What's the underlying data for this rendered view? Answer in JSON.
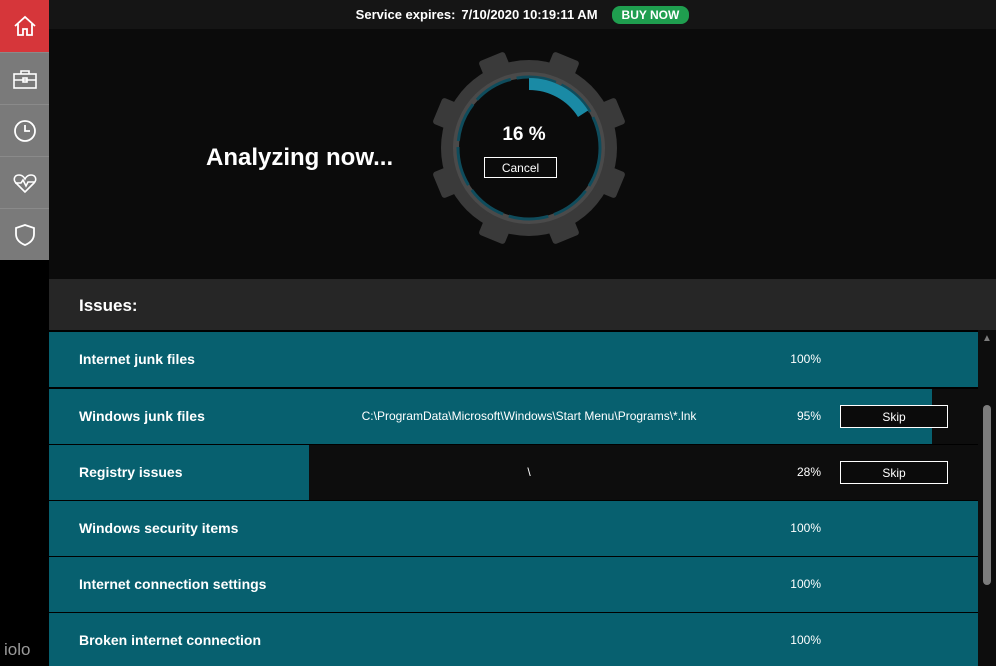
{
  "sidebar": {
    "items": [
      {
        "icon": "home-icon",
        "active": true
      },
      {
        "icon": "briefcase-icon",
        "active": false
      },
      {
        "icon": "clock-icon",
        "active": false
      },
      {
        "icon": "heartbeat-icon",
        "active": false
      },
      {
        "icon": "shield-icon",
        "active": false
      }
    ],
    "logo": "iolo"
  },
  "header": {
    "service_label": "Service expires:",
    "service_value": "7/10/2020 10:19:11 AM",
    "buy_label": "BUY NOW"
  },
  "analyze": {
    "title": "Analyzing now...",
    "percent_text": "16 %",
    "progress": 0.16,
    "cancel_label": "Cancel"
  },
  "issues": {
    "title": "Issues:",
    "items": [
      {
        "name": "Internet junk files",
        "path": "",
        "percent": "100%",
        "progress": 1.0,
        "skip_label": ""
      },
      {
        "name": "Windows junk files",
        "path": "C:\\ProgramData\\Microsoft\\Windows\\Start Menu\\Programs\\*.lnk",
        "percent": "95%",
        "progress": 0.95,
        "skip_label": "Skip"
      },
      {
        "name": "Registry issues",
        "path": "\\",
        "percent": "28%",
        "progress": 0.28,
        "skip_label": "Skip"
      },
      {
        "name": "Windows security items",
        "path": "",
        "percent": "100%",
        "progress": 1.0,
        "skip_label": ""
      },
      {
        "name": "Internet connection settings",
        "path": "",
        "percent": "100%",
        "progress": 1.0,
        "skip_label": ""
      },
      {
        "name": "Broken internet connection",
        "path": "",
        "percent": "100%",
        "progress": 1.0,
        "skip_label": ""
      }
    ]
  },
  "colors": {
    "accent_red": "#d6363a",
    "teal": "#07606f",
    "progress_cyan": "#1a8aa5",
    "buy_green": "#1f9e4f"
  }
}
